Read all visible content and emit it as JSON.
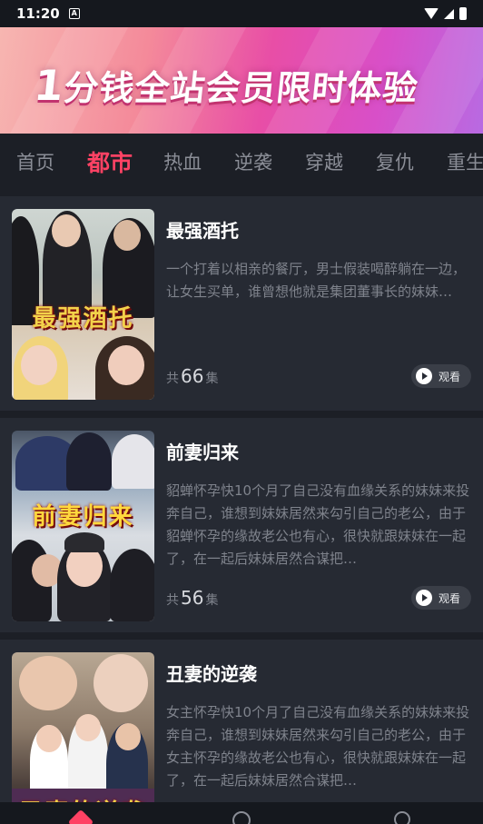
{
  "status_bar": {
    "time": "11:20",
    "notification_icon": "a-icon",
    "icons": [
      "wifi-icon",
      "signal-icon",
      "battery-icon"
    ]
  },
  "banner": {
    "text_big": "1",
    "text": "分钱全站会员限时体验"
  },
  "tabs": [
    {
      "label": "首页",
      "active": false
    },
    {
      "label": "都市",
      "active": true
    },
    {
      "label": "热血",
      "active": false
    },
    {
      "label": "逆袭",
      "active": false
    },
    {
      "label": "穿越",
      "active": false
    },
    {
      "label": "复仇",
      "active": false
    },
    {
      "label": "重生",
      "active": false
    }
  ],
  "colors": {
    "accent": "#ff4264",
    "background": "#1c1f26",
    "card": "#262a33"
  },
  "dramas": [
    {
      "poster_title": "最强酒托",
      "title": "最强酒托",
      "description": "一个打着以相亲的餐厅，男士假装喝醉躺在一边，让女生买单，谁曾想他就是集团董事长的妹妹…",
      "count_prefix": "共",
      "count": "66",
      "count_suffix": "集",
      "watch_label": "观看"
    },
    {
      "poster_title": "前妻归来",
      "title": "前妻归来",
      "description": "貂蝉怀孕快10个月了自己没有血缘关系的妹妹来投奔自己，谁想到妹妹居然来勾引自己的老公，由于貂蝉怀孕的缘故老公也有心，很快就跟妹妹在一起了，在一起后妹妹居然合谋把…",
      "count_prefix": "共",
      "count": "56",
      "count_suffix": "集",
      "watch_label": "观看"
    },
    {
      "poster_title": "丑妻的逆袭",
      "title": "丑妻的逆袭",
      "description": "女主怀孕快10个月了自己没有血缘关系的妹妹来投奔自己，谁想到妹妹居然来勾引自己的老公，由于女主怀孕的缘故老公也有心，很快就跟妹妹在一起了，在一起后妹妹居然合谋把…",
      "count_prefix": "共",
      "count": "",
      "count_suffix": "",
      "watch_label": ""
    }
  ],
  "bottom_nav": [
    "home-icon",
    "discover-icon",
    "search-icon"
  ]
}
